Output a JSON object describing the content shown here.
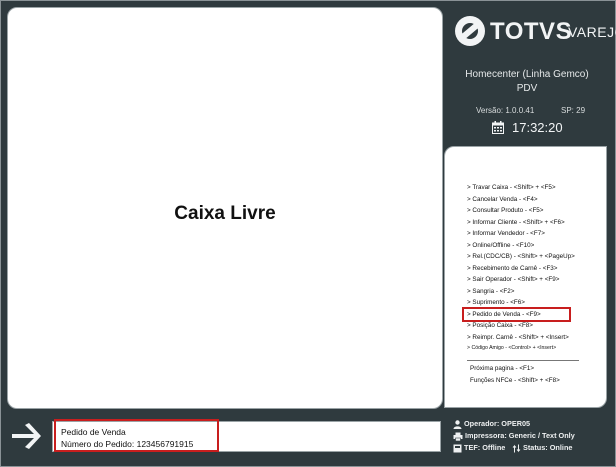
{
  "brand": {
    "name": "TOTVS",
    "sub": "VAREJO"
  },
  "store": {
    "name": "Homecenter (Linha Gemco)",
    "mode": "PDV"
  },
  "version": {
    "label": "Versão: 1.0.0.41",
    "sp": "SP: 29"
  },
  "clock": "17:32:20",
  "main": {
    "title": "Caixa Livre"
  },
  "menu": {
    "items": [
      "> Travar Caixa - <Shift> + <F5>",
      "> Cancelar Venda - <F4>",
      "> Consultar Produto - <F5>",
      "> Informar Cliente - <Shift> + <F6>",
      "> Informar Vendedor - <F7>",
      "> Online/Offline - <F10>",
      "> Rel.(CDC/CB) - <Shift> + <PageUp>",
      "> Recebimento de Carnê - <F3>",
      "> Sair Operador - <Shift> + <F9>",
      "> Sangria - <F2>",
      "> Suprimento - <F6>",
      "> Pedido de Venda - <F9>",
      "> Posição Caixa - <F8>",
      "> Reimpr. Carnê - <Shift> + <Insert>",
      "> Código Amigo - <Control> + <Insert>"
    ],
    "footer": [
      "Próxima pagina - <F1>",
      "Funções NFCe - <Shift> + <F8>"
    ]
  },
  "order": {
    "line1": "Pedido de Venda",
    "line2": "Número do Pedido:  123456791915"
  },
  "status": {
    "operator": "Operador: OPER05",
    "printer": "Impressora: Generic / Text Only",
    "tef": "TEF: Offline",
    "status": "Status: Online"
  },
  "colors": {
    "background": "#2f3a3e",
    "highlight": "#c81e1e",
    "panel": "#ffffff"
  }
}
